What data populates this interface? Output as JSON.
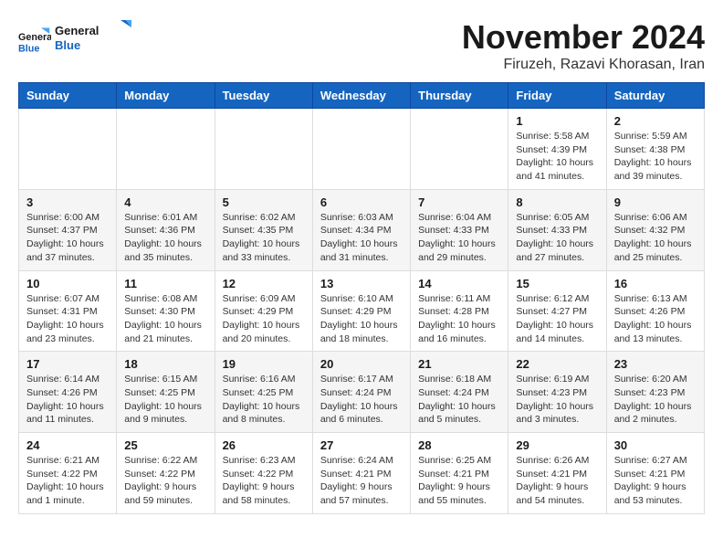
{
  "header": {
    "logo_text_general": "General",
    "logo_text_blue": "Blue",
    "month_title": "November 2024",
    "location": "Firuzeh, Razavi Khorasan, Iran"
  },
  "days_of_week": [
    "Sunday",
    "Monday",
    "Tuesday",
    "Wednesday",
    "Thursday",
    "Friday",
    "Saturday"
  ],
  "weeks": [
    [
      {
        "day": "",
        "info": ""
      },
      {
        "day": "",
        "info": ""
      },
      {
        "day": "",
        "info": ""
      },
      {
        "day": "",
        "info": ""
      },
      {
        "day": "",
        "info": ""
      },
      {
        "day": "1",
        "info": "Sunrise: 5:58 AM\nSunset: 4:39 PM\nDaylight: 10 hours and 41 minutes."
      },
      {
        "day": "2",
        "info": "Sunrise: 5:59 AM\nSunset: 4:38 PM\nDaylight: 10 hours and 39 minutes."
      }
    ],
    [
      {
        "day": "3",
        "info": "Sunrise: 6:00 AM\nSunset: 4:37 PM\nDaylight: 10 hours and 37 minutes."
      },
      {
        "day": "4",
        "info": "Sunrise: 6:01 AM\nSunset: 4:36 PM\nDaylight: 10 hours and 35 minutes."
      },
      {
        "day": "5",
        "info": "Sunrise: 6:02 AM\nSunset: 4:35 PM\nDaylight: 10 hours and 33 minutes."
      },
      {
        "day": "6",
        "info": "Sunrise: 6:03 AM\nSunset: 4:34 PM\nDaylight: 10 hours and 31 minutes."
      },
      {
        "day": "7",
        "info": "Sunrise: 6:04 AM\nSunset: 4:33 PM\nDaylight: 10 hours and 29 minutes."
      },
      {
        "day": "8",
        "info": "Sunrise: 6:05 AM\nSunset: 4:33 PM\nDaylight: 10 hours and 27 minutes."
      },
      {
        "day": "9",
        "info": "Sunrise: 6:06 AM\nSunset: 4:32 PM\nDaylight: 10 hours and 25 minutes."
      }
    ],
    [
      {
        "day": "10",
        "info": "Sunrise: 6:07 AM\nSunset: 4:31 PM\nDaylight: 10 hours and 23 minutes."
      },
      {
        "day": "11",
        "info": "Sunrise: 6:08 AM\nSunset: 4:30 PM\nDaylight: 10 hours and 21 minutes."
      },
      {
        "day": "12",
        "info": "Sunrise: 6:09 AM\nSunset: 4:29 PM\nDaylight: 10 hours and 20 minutes."
      },
      {
        "day": "13",
        "info": "Sunrise: 6:10 AM\nSunset: 4:29 PM\nDaylight: 10 hours and 18 minutes."
      },
      {
        "day": "14",
        "info": "Sunrise: 6:11 AM\nSunset: 4:28 PM\nDaylight: 10 hours and 16 minutes."
      },
      {
        "day": "15",
        "info": "Sunrise: 6:12 AM\nSunset: 4:27 PM\nDaylight: 10 hours and 14 minutes."
      },
      {
        "day": "16",
        "info": "Sunrise: 6:13 AM\nSunset: 4:26 PM\nDaylight: 10 hours and 13 minutes."
      }
    ],
    [
      {
        "day": "17",
        "info": "Sunrise: 6:14 AM\nSunset: 4:26 PM\nDaylight: 10 hours and 11 minutes."
      },
      {
        "day": "18",
        "info": "Sunrise: 6:15 AM\nSunset: 4:25 PM\nDaylight: 10 hours and 9 minutes."
      },
      {
        "day": "19",
        "info": "Sunrise: 6:16 AM\nSunset: 4:25 PM\nDaylight: 10 hours and 8 minutes."
      },
      {
        "day": "20",
        "info": "Sunrise: 6:17 AM\nSunset: 4:24 PM\nDaylight: 10 hours and 6 minutes."
      },
      {
        "day": "21",
        "info": "Sunrise: 6:18 AM\nSunset: 4:24 PM\nDaylight: 10 hours and 5 minutes."
      },
      {
        "day": "22",
        "info": "Sunrise: 6:19 AM\nSunset: 4:23 PM\nDaylight: 10 hours and 3 minutes."
      },
      {
        "day": "23",
        "info": "Sunrise: 6:20 AM\nSunset: 4:23 PM\nDaylight: 10 hours and 2 minutes."
      }
    ],
    [
      {
        "day": "24",
        "info": "Sunrise: 6:21 AM\nSunset: 4:22 PM\nDaylight: 10 hours and 1 minute."
      },
      {
        "day": "25",
        "info": "Sunrise: 6:22 AM\nSunset: 4:22 PM\nDaylight: 9 hours and 59 minutes."
      },
      {
        "day": "26",
        "info": "Sunrise: 6:23 AM\nSunset: 4:22 PM\nDaylight: 9 hours and 58 minutes."
      },
      {
        "day": "27",
        "info": "Sunrise: 6:24 AM\nSunset: 4:21 PM\nDaylight: 9 hours and 57 minutes."
      },
      {
        "day": "28",
        "info": "Sunrise: 6:25 AM\nSunset: 4:21 PM\nDaylight: 9 hours and 55 minutes."
      },
      {
        "day": "29",
        "info": "Sunrise: 6:26 AM\nSunset: 4:21 PM\nDaylight: 9 hours and 54 minutes."
      },
      {
        "day": "30",
        "info": "Sunrise: 6:27 AM\nSunset: 4:21 PM\nDaylight: 9 hours and 53 minutes."
      }
    ]
  ]
}
